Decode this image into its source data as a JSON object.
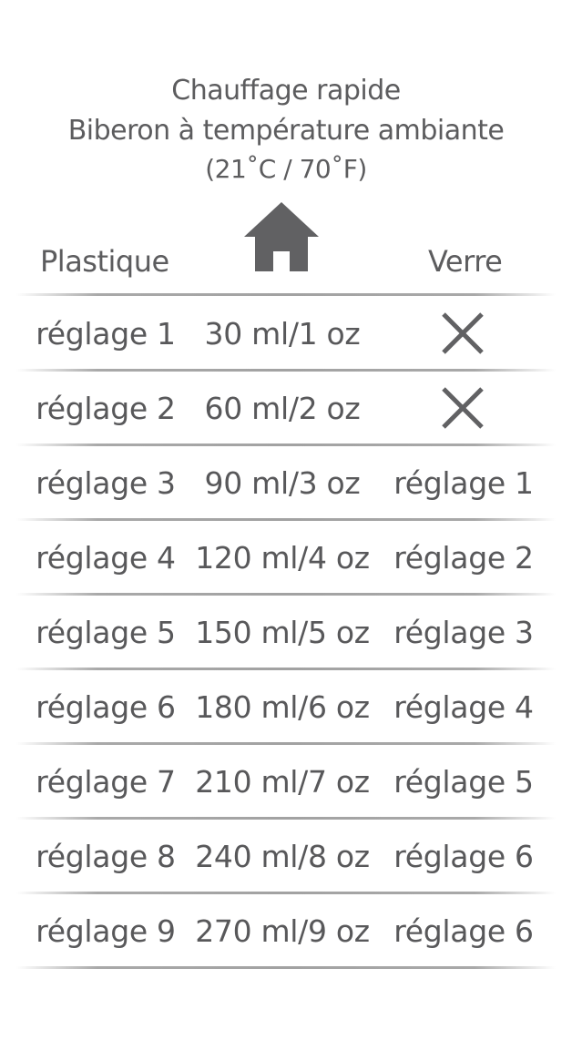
{
  "heading": {
    "line1": "Chauffage rapide",
    "line2": "Biberon à température ambiante",
    "line3": "(21˚C / 70˚F)"
  },
  "columns": {
    "left": "Plastique",
    "middle_icon": "home-icon",
    "right": "Verre"
  },
  "rows": [
    {
      "plastic": "réglage 1",
      "volume": "30 ml/1 oz",
      "glass": null,
      "glass_icon": "x-icon"
    },
    {
      "plastic": "réglage 2",
      "volume": "60 ml/2 oz",
      "glass": null,
      "glass_icon": "x-icon"
    },
    {
      "plastic": "réglage 3",
      "volume": "90 ml/3 oz",
      "glass": "réglage 1"
    },
    {
      "plastic": "réglage 4",
      "volume": "120 ml/4 oz",
      "glass": "réglage 2"
    },
    {
      "plastic": "réglage 5",
      "volume": "150 ml/5 oz",
      "glass": "réglage 3"
    },
    {
      "plastic": "réglage 6",
      "volume": "180 ml/6 oz",
      "glass": "réglage 4"
    },
    {
      "plastic": "réglage 7",
      "volume": "210 ml/7 oz",
      "glass": "réglage 5"
    },
    {
      "plastic": "réglage 8",
      "volume": "240 ml/8 oz",
      "glass": "réglage 6"
    },
    {
      "plastic": "réglage 9",
      "volume": "270 ml/9 oz",
      "glass": "réglage 6"
    }
  ],
  "colors": {
    "text": "#58585a",
    "icon": "#616163",
    "divider": "#a4a4a4"
  }
}
